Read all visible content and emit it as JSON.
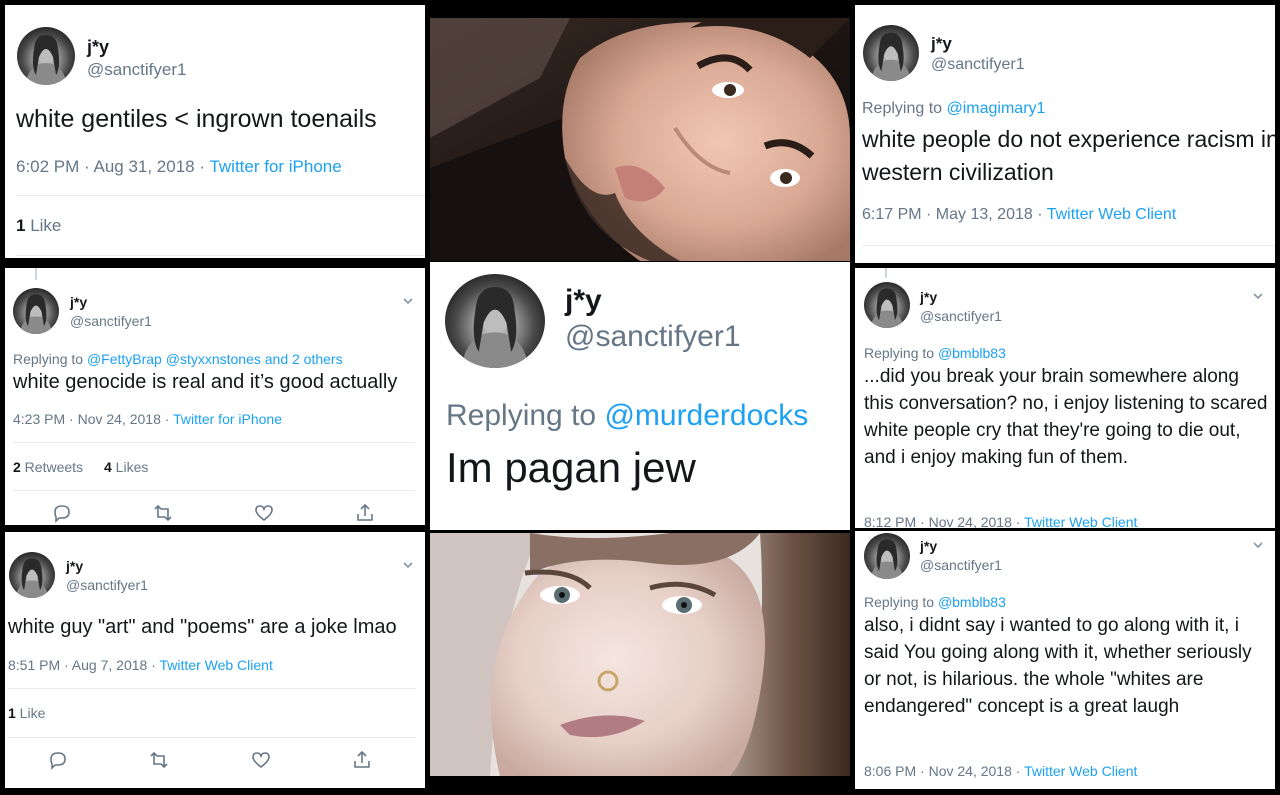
{
  "user": {
    "name": "j*y",
    "handle": "@sanctifyer1"
  },
  "tweet1": {
    "text": "white gentiles < ingrown toenails",
    "time": "6:02 PM · Aug 31, 2018 · ",
    "source": "Twitter for iPhone",
    "likes_num": "1",
    "likes_label": " Like"
  },
  "tweet2": {
    "reply_prefix": "Replying to ",
    "reply_to": "@imagimary1",
    "text": "white people do not experience racism in western civilization",
    "time": "6:17 PM · May 13, 2018 · ",
    "source": "Twitter Web Client"
  },
  "tweet3": {
    "reply_prefix": "Replying to ",
    "reply_to": "@FettyBrap @styxxnstones and 2 others",
    "text": "white genocide is real and it’s good actually",
    "time": "4:23 PM · Nov 24, 2018 · ",
    "source": "Twitter for iPhone",
    "retweets_num": "2",
    "retweets_label": " Retweets",
    "likes_num": "4",
    "likes_label": " Likes"
  },
  "tweet4": {
    "reply_prefix": "Replying to ",
    "reply_to": "@murderdocks",
    "text": "Im pagan jew"
  },
  "tweet5": {
    "reply_prefix": "Replying to ",
    "reply_to": "@bmblb83",
    "text": "...did you break your brain somewhere along this conversation? no, i enjoy listening to scared white people cry that they're going to die out, and i enjoy making fun of them.",
    "time": "8:12 PM · Nov 24, 2018 · ",
    "source": "Twitter Web Client"
  },
  "tweet6": {
    "text": "white guy \"art\" and \"poems\" are a joke lmao",
    "time": "8:51 PM · Aug 7, 2018 · ",
    "source": "Twitter Web Client",
    "likes_num": "1",
    "likes_label": " Like"
  },
  "tweet7": {
    "reply_prefix": "Replying to ",
    "reply_to": "@bmblb83",
    "text": "also, i didnt say i wanted to go along with it, i said You going along with it, whether seriously or not, is hilarious. the whole \"whites are endangered\" concept is a great laugh",
    "time": "8:06 PM · Nov 24, 2018 · ",
    "source": "Twitter Web Client"
  },
  "colors": {
    "link": "#1da1f2",
    "secondary": "#657786",
    "text": "#14171a",
    "divider": "#e6ecf0"
  },
  "icons": [
    "reply-icon",
    "retweet-icon",
    "like-icon",
    "share-icon",
    "chevron-down-icon"
  ]
}
